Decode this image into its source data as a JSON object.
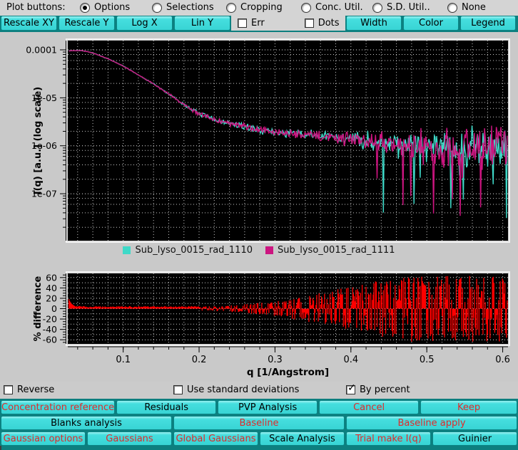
{
  "toolbar": {
    "label": "Plot buttons:",
    "radios": [
      {
        "label": "Options",
        "selected": true
      },
      {
        "label": "Selections",
        "selected": false
      },
      {
        "label": "Cropping",
        "selected": false
      },
      {
        "label": "Conc. Util.",
        "selected": false
      },
      {
        "label": "S.D. Util..",
        "selected": false
      },
      {
        "label": "None",
        "selected": false
      }
    ]
  },
  "plot_controls": {
    "left_buttons": [
      "Rescale XY",
      "Rescale Y",
      "Log X",
      "Lin Y"
    ],
    "checkboxes": [
      {
        "label": "Err",
        "checked": false
      },
      {
        "label": "Dots",
        "checked": false
      }
    ],
    "right_buttons": [
      "Width",
      "Color",
      "Legend"
    ]
  },
  "chart_data": [
    {
      "type": "line",
      "ylabel": "I(q) [a.u.] (log scale)",
      "xlabel": "q [1/Angstrom]",
      "x_ticks": [
        0.1,
        0.2,
        0.3,
        0.4,
        0.5,
        0.6
      ],
      "x_minor_step": 0.02,
      "xlim": [
        0.027,
        0.607
      ],
      "y_ticks": [
        {
          "label": "0.0001",
          "value": 0.0001
        },
        {
          "label": "1e-05",
          "value": 1e-05
        },
        {
          "label": "1e-06",
          "value": 1e-06
        },
        {
          "label": "1e-07",
          "value": 1e-07
        }
      ],
      "ylim_log": [
        1.05e-08,
        0.000156
      ],
      "grid": "dotted",
      "canvas_bg": "#000000",
      "series": [
        {
          "name": "Sub_lyso_0015_rad_1110",
          "color": "#3fd9c8",
          "seed": 7
        },
        {
          "name": "Sub_lyso_0015_rad_1111",
          "color": "#cc1580",
          "seed": 13
        }
      ],
      "backbone": [
        [
          0.0285,
          9.6e-05
        ],
        [
          0.045,
          9.7e-05
        ],
        [
          0.06,
          8.6e-05
        ],
        [
          0.08,
          6.5e-05
        ],
        [
          0.1,
          4.6e-05
        ],
        [
          0.12,
          3e-05
        ],
        [
          0.14,
          1.95e-05
        ],
        [
          0.16,
          1.2e-05
        ],
        [
          0.18,
          7.2e-06
        ],
        [
          0.2,
          4.7e-06
        ],
        [
          0.22,
          3.5e-06
        ],
        [
          0.24,
          2.9e-06
        ],
        [
          0.27,
          2.3e-06
        ],
        [
          0.3,
          1.9e-06
        ],
        [
          0.34,
          1.7e-06
        ],
        [
          0.38,
          1.5e-06
        ],
        [
          0.42,
          1.3e-06
        ],
        [
          0.46,
          1.1e-06
        ],
        [
          0.5,
          1e-06
        ],
        [
          0.54,
          9e-07
        ],
        [
          0.58,
          9e-07
        ],
        [
          0.606,
          1e-06
        ]
      ],
      "noise_sigma_decades": [
        [
          0.0285,
          0.004
        ],
        [
          0.12,
          0.006
        ],
        [
          0.17,
          0.02
        ],
        [
          0.22,
          0.045
        ],
        [
          0.3,
          0.06
        ],
        [
          0.38,
          0.09
        ],
        [
          0.44,
          0.16
        ],
        [
          0.52,
          0.3
        ],
        [
          0.606,
          0.38
        ]
      ],
      "points": 560
    },
    {
      "type": "sticks",
      "ylabel": "% difference",
      "y_ticks": [
        60,
        40,
        20,
        0,
        -20,
        -40,
        -60
      ],
      "ylim": [
        -68,
        68
      ],
      "color": "#ff0000",
      "canvas_bg": "#000000",
      "start_spike": 16,
      "base_level": 3,
      "amplitude": [
        [
          0.0285,
          2
        ],
        [
          0.18,
          2.5
        ],
        [
          0.24,
          6
        ],
        [
          0.3,
          14
        ],
        [
          0.36,
          30
        ],
        [
          0.42,
          50
        ],
        [
          0.48,
          64
        ],
        [
          0.606,
          64
        ]
      ],
      "clip": 64,
      "seed": 29,
      "points": 560
    }
  ],
  "options_row": {
    "checkboxes": [
      {
        "label": "Reverse",
        "checked": false
      },
      {
        "label": "Use standard deviations",
        "checked": false
      },
      {
        "label": "By percent",
        "checked": true
      }
    ]
  },
  "action_rows": [
    [
      {
        "label": "Concentration reference",
        "style": "red"
      },
      {
        "label": "Residuals",
        "style": "black"
      },
      {
        "label": "PVP Analysis",
        "style": "black"
      },
      {
        "label": "Cancel",
        "style": "red"
      },
      {
        "label": "Keep",
        "style": "red"
      }
    ],
    [
      {
        "label": "Blanks analysis",
        "style": "black"
      },
      {
        "label": "Baseline",
        "style": "red"
      },
      {
        "label": "Baseline apply",
        "style": "red"
      }
    ],
    [
      {
        "label": "Gaussian options",
        "style": "red"
      },
      {
        "label": "Gaussians",
        "style": "red"
      },
      {
        "label": "Global Gaussians",
        "style": "red"
      },
      {
        "label": "Scale Analysis",
        "style": "black"
      },
      {
        "label": "Trial make I(q)",
        "style": "red"
      },
      {
        "label": "Guinier",
        "style": "black"
      }
    ]
  ]
}
